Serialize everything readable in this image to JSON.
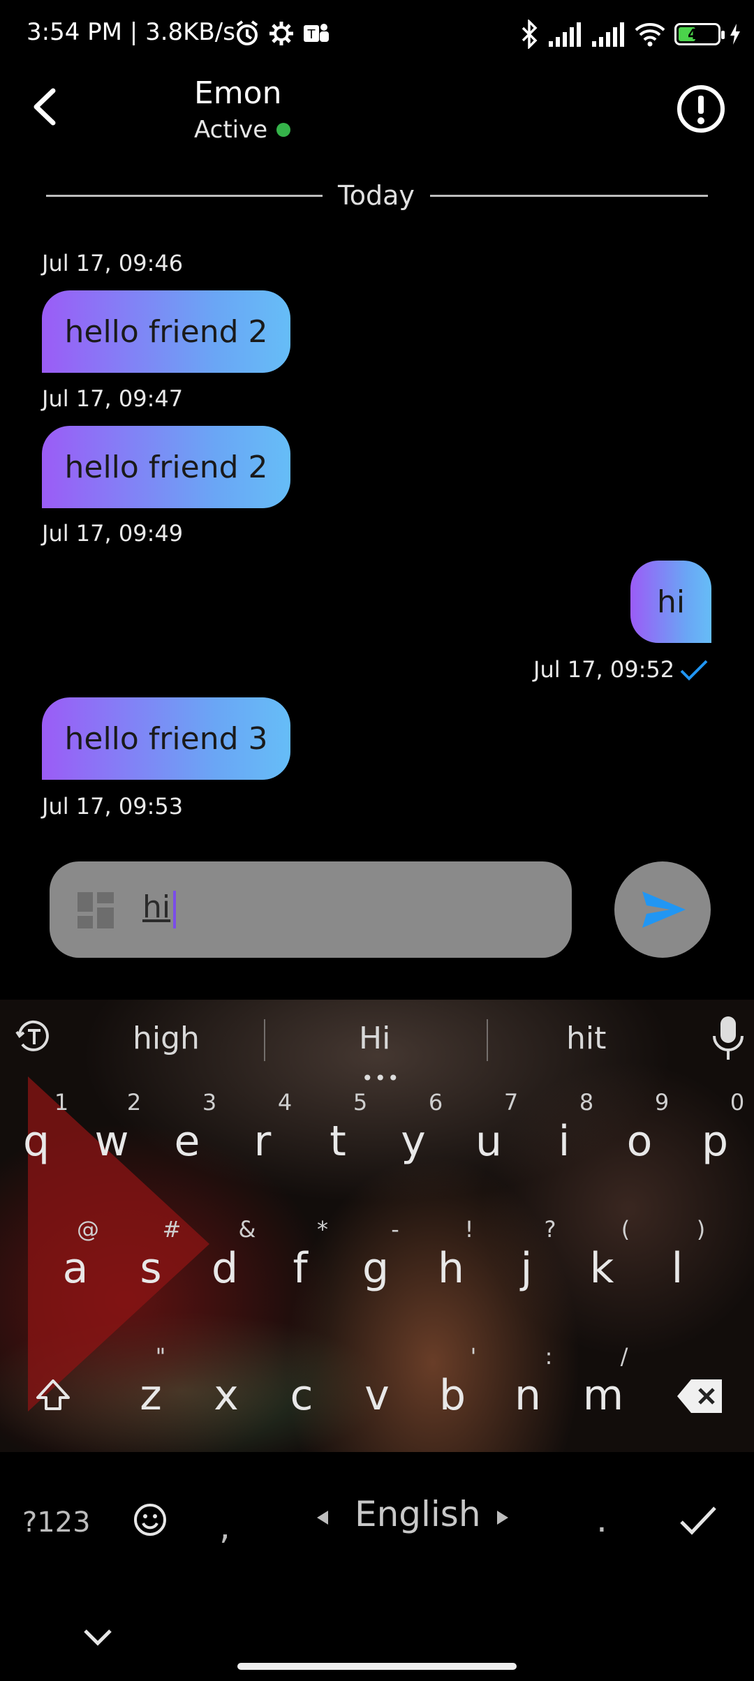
{
  "status_bar": {
    "text": "3:54 PM | 3.8KB/s",
    "battery": "40",
    "icons": [
      "alarm-icon",
      "gear-icon",
      "teams-icon",
      "bluetooth-icon",
      "signal-icon",
      "signal-icon",
      "wifi-icon",
      "battery-icon",
      "charging-icon"
    ]
  },
  "header": {
    "name": "Emon",
    "status": "Active",
    "status_color": "#35b34a"
  },
  "divider_label": "Today",
  "messages": [
    {
      "direction": "in",
      "text": "hello friend 2",
      "time_above": "Jul 17, 09:46"
    },
    {
      "direction": "in",
      "text": "hello friend 2",
      "time_above": "Jul 17, 09:47"
    },
    {
      "direction": "out",
      "text": "hi",
      "time_above": "Jul 17, 09:49",
      "time_below": "Jul 17, 09:52"
    },
    {
      "direction": "in",
      "text": "hello friend 3",
      "time_below": "Jul 17, 09:53"
    }
  ],
  "composer": {
    "value": "hi"
  },
  "keyboard": {
    "suggestions": [
      "high",
      "Hi",
      "hit"
    ],
    "suggestion_dots": "•••",
    "row1_hints": [
      "1",
      "2",
      "3",
      "4",
      "5",
      "6",
      "7",
      "8",
      "9",
      "0"
    ],
    "row1_keys": [
      "q",
      "w",
      "e",
      "r",
      "t",
      "y",
      "u",
      "i",
      "o",
      "p"
    ],
    "row2_hints": [
      "@",
      "#",
      "&",
      "*",
      "-",
      "!",
      "?",
      "(",
      ")"
    ],
    "row2_keys": [
      "a",
      "s",
      "d",
      "f",
      "g",
      "h",
      "j",
      "k",
      "l"
    ],
    "row3_hints": [
      "\"",
      "",
      "",
      "",
      "'",
      ":",
      "/"
    ],
    "row3_keys": [
      "z",
      "x",
      "c",
      "v",
      "b",
      "n",
      "m"
    ],
    "symbols_key": "?123",
    "comma_key": ",",
    "period_key": ".",
    "language": "English"
  }
}
